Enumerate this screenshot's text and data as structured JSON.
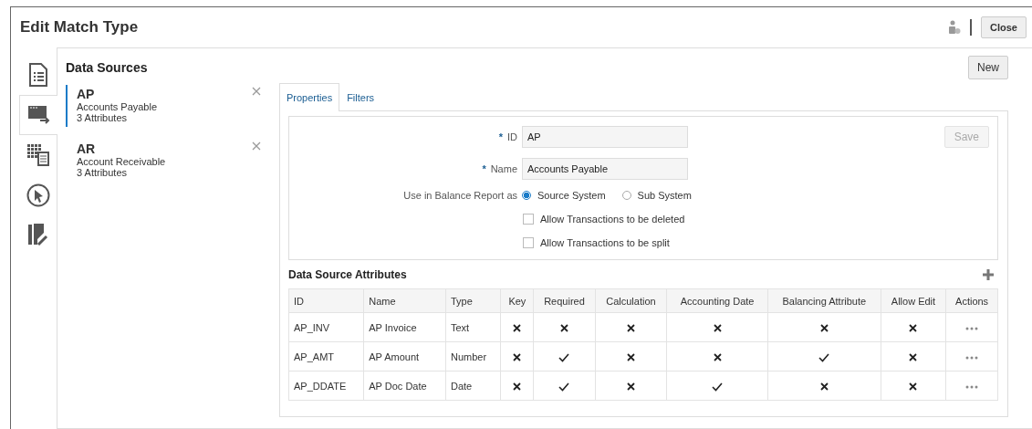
{
  "window": {
    "title": "Edit Match Type",
    "close_button": "Close"
  },
  "rail": [
    {
      "selected": false
    },
    {
      "selected": true
    },
    {
      "selected": false
    },
    {
      "selected": false
    },
    {
      "selected": false
    }
  ],
  "data_sources": {
    "title": "Data Sources",
    "new_button": "New",
    "items": [
      {
        "id": "AP",
        "name": "Accounts Payable",
        "attributes": "3 Attributes",
        "selected": true
      },
      {
        "id": "AR",
        "name": "Account Receivable",
        "attributes": "3 Attributes",
        "selected": false
      }
    ]
  },
  "tabs": [
    {
      "label": "Properties",
      "selected": true
    },
    {
      "label": "Filters",
      "selected": false
    }
  ],
  "properties": {
    "save_button": "Save",
    "required_mark": "*",
    "id_label": "ID",
    "id_value": "AP",
    "name_label": "Name",
    "name_value": "Accounts Payable",
    "balance_label": "Use in Balance Report as",
    "balance_options": [
      {
        "label": "Source System",
        "selected": true
      },
      {
        "label": "Sub System",
        "selected": false
      }
    ],
    "checkboxes": [
      {
        "label": "Allow Transactions to be deleted",
        "checked": false
      },
      {
        "label": "Allow Transactions to be split",
        "checked": false
      }
    ]
  },
  "attributes": {
    "title": "Data Source Attributes",
    "columns": [
      "ID",
      "Name",
      "Type",
      "Key",
      "Required",
      "Calculation",
      "Accounting Date",
      "Balancing Attribute",
      "Allow Edit",
      "Actions"
    ],
    "rows": [
      {
        "id": "AP_INV",
        "name": "AP Invoice",
        "type": "Text",
        "flags": [
          false,
          false,
          false,
          false,
          false,
          false
        ]
      },
      {
        "id": "AP_AMT",
        "name": "AP Amount",
        "type": "Number",
        "flags": [
          false,
          true,
          false,
          false,
          true,
          false
        ]
      },
      {
        "id": "AP_DDATE",
        "name": "AP Doc Date",
        "type": "Date",
        "flags": [
          false,
          true,
          false,
          true,
          false,
          false
        ]
      }
    ]
  }
}
